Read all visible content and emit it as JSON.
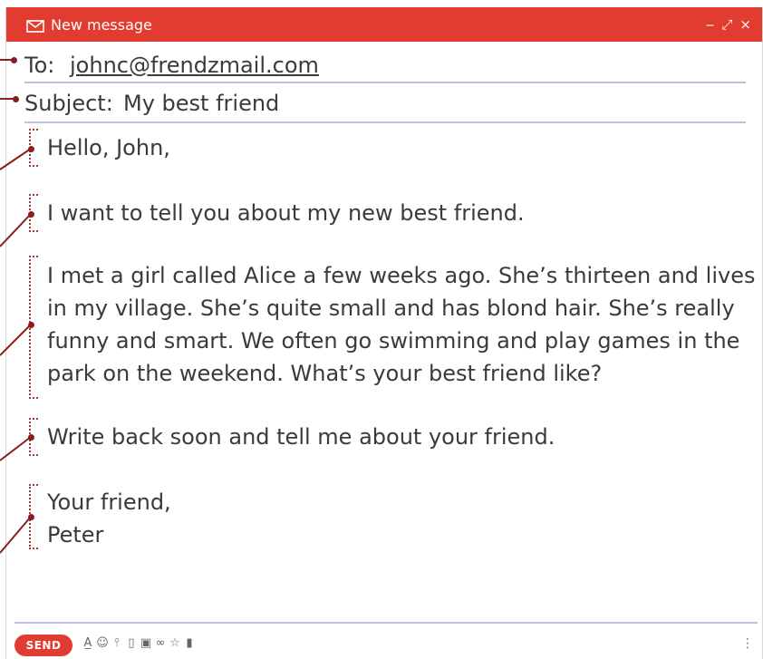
{
  "window": {
    "title": "New message",
    "controls": [
      "‒",
      "⤢",
      "×"
    ],
    "accent_color": "#e23b2f"
  },
  "to": {
    "label": "To:",
    "value": "johnc@frendzmail.com"
  },
  "subject": {
    "label": "Subject:",
    "value": "My best friend"
  },
  "body": {
    "greeting": "Hello, John,",
    "intro": "I want to tell you about my new best friend.",
    "main_lines": [
      "I met a girl called Alice a few weeks ago. She’s thirteen and lives",
      "in my village. She’s quite small and has blond hair. She’s really",
      "funny and smart. We often go swimming and play games in the",
      "park on the weekend. What’s your best friend like?"
    ],
    "closing": "Write back soon and tell me about your friend.",
    "signoff_lines": [
      "Your friend,",
      "Peter"
    ]
  },
  "footer": {
    "send_label": "SEND",
    "tool_icons": [
      "font-format-icon",
      "emoji-icon",
      "attach-icon",
      "drive-icon",
      "image-icon",
      "link-icon",
      "star-icon",
      "trash-icon"
    ],
    "more_icon": "more-vertical-icon"
  }
}
